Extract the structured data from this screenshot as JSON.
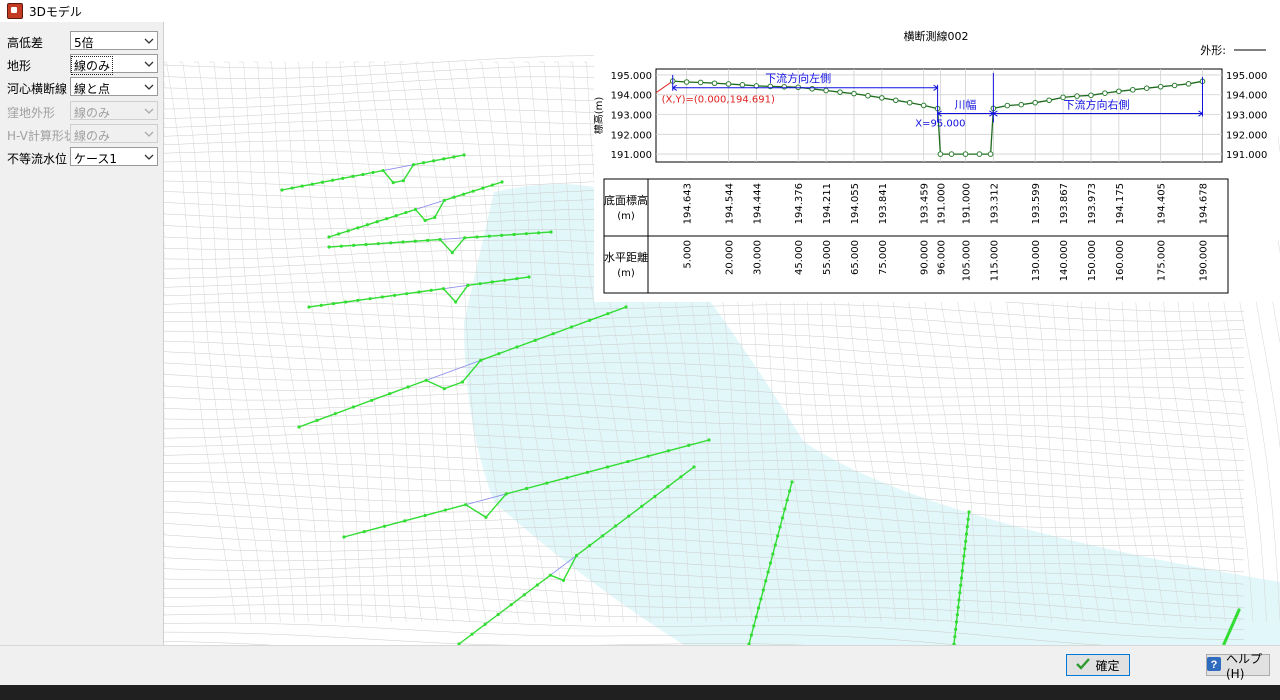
{
  "window": {
    "title": "3Dモデル"
  },
  "controls": [
    {
      "label": "高低差",
      "value": "5倍",
      "enabled": true,
      "focused": false
    },
    {
      "label": "地形",
      "value": "線のみ",
      "enabled": true,
      "focused": true
    },
    {
      "label": "河心横断線",
      "value": "線と点",
      "enabled": true,
      "focused": false
    },
    {
      "label": "窪地外形",
      "value": "線のみ",
      "enabled": false,
      "focused": false
    },
    {
      "label": "H-V計算形状",
      "value": "線のみ",
      "enabled": false,
      "focused": false
    },
    {
      "label": "不等流水位",
      "value": "ケース1",
      "enabled": true,
      "focused": false
    }
  ],
  "chart_data": {
    "type": "line",
    "title": "横断測線002",
    "legend": {
      "label": "外形:",
      "placement": "top-right"
    },
    "ylabel": "標高(m)",
    "yticks": [
      "195.000",
      "194.000",
      "193.000",
      "192.000",
      "191.000"
    ],
    "ylim": [
      190.6,
      195.3
    ],
    "xlim": [
      -6,
      197
    ],
    "points": [
      {
        "x": 0,
        "y": 194.691
      },
      {
        "x": 5,
        "y": 194.643
      },
      {
        "x": 10,
        "y": 194.62
      },
      {
        "x": 15,
        "y": 194.58
      },
      {
        "x": 20,
        "y": 194.544
      },
      {
        "x": 25,
        "y": 194.5
      },
      {
        "x": 30,
        "y": 194.444
      },
      {
        "x": 35,
        "y": 194.42
      },
      {
        "x": 40,
        "y": 194.4
      },
      {
        "x": 45,
        "y": 194.376
      },
      {
        "x": 50,
        "y": 194.3
      },
      {
        "x": 55,
        "y": 194.211
      },
      {
        "x": 60,
        "y": 194.13
      },
      {
        "x": 65,
        "y": 194.055
      },
      {
        "x": 70,
        "y": 193.95
      },
      {
        "x": 75,
        "y": 193.841
      },
      {
        "x": 80,
        "y": 193.72
      },
      {
        "x": 85,
        "y": 193.6
      },
      {
        "x": 90,
        "y": 193.459
      },
      {
        "x": 95,
        "y": 193.3
      },
      {
        "x": 96,
        "y": 191.0
      },
      {
        "x": 100,
        "y": 191.0
      },
      {
        "x": 105,
        "y": 191.0
      },
      {
        "x": 110,
        "y": 191.0
      },
      {
        "x": 114,
        "y": 191.0
      },
      {
        "x": 115,
        "y": 193.312
      },
      {
        "x": 120,
        "y": 193.45
      },
      {
        "x": 125,
        "y": 193.5
      },
      {
        "x": 130,
        "y": 193.599
      },
      {
        "x": 135,
        "y": 193.72
      },
      {
        "x": 140,
        "y": 193.867
      },
      {
        "x": 145,
        "y": 193.93
      },
      {
        "x": 150,
        "y": 193.973
      },
      {
        "x": 155,
        "y": 194.08
      },
      {
        "x": 160,
        "y": 194.175
      },
      {
        "x": 165,
        "y": 194.25
      },
      {
        "x": 170,
        "y": 194.33
      },
      {
        "x": 175,
        "y": 194.405
      },
      {
        "x": 180,
        "y": 194.47
      },
      {
        "x": 185,
        "y": 194.55
      },
      {
        "x": 190,
        "y": 194.678
      }
    ],
    "annotations": {
      "left_bank": "下流方向左側",
      "river_width": "川幅",
      "right_bank": "下流方向右側",
      "origin_point": "(X,Y)=(0.000,194.691)",
      "river_x": "X=95.000"
    },
    "table": {
      "elevation_header": "底面標高",
      "distance_header": "水平距離",
      "unit": "(m)",
      "columns": [
        {
          "distance": "5.000",
          "elevation": "194.643",
          "x": 5
        },
        {
          "distance": "20.000",
          "elevation": "194.544",
          "x": 20
        },
        {
          "distance": "30.000",
          "elevation": "194.444",
          "x": 30
        },
        {
          "distance": "45.000",
          "elevation": "194.376",
          "x": 45
        },
        {
          "distance": "55.000",
          "elevation": "194.211",
          "x": 55
        },
        {
          "distance": "65.000",
          "elevation": "194.055",
          "x": 65
        },
        {
          "distance": "75.000",
          "elevation": "193.841",
          "x": 75
        },
        {
          "distance": "90.000",
          "elevation": "193.459",
          "x": 90
        },
        {
          "distance": "96.000",
          "elevation": "191.000",
          "x": 96
        },
        {
          "distance": "105.000",
          "elevation": "191.000",
          "x": 105
        },
        {
          "distance": "115.000",
          "elevation": "193.312",
          "x": 115
        },
        {
          "distance": "130.000",
          "elevation": "193.599",
          "x": 130
        },
        {
          "distance": "140.000",
          "elevation": "193.867",
          "x": 140
        },
        {
          "distance": "150.000",
          "elevation": "193.973",
          "x": 150
        },
        {
          "distance": "160.000",
          "elevation": "194.175",
          "x": 160
        },
        {
          "distance": "175.000",
          "elevation": "194.405",
          "x": 175
        },
        {
          "distance": "190.000",
          "elevation": "194.678",
          "x": 190
        }
      ]
    }
  },
  "buttons": {
    "ok": "確定",
    "help": "ヘルプ(H)"
  },
  "colors": {
    "profile": "#1e6b1e",
    "point": "#2e7d32",
    "annotation": "#1010e0",
    "origin": "#e02020",
    "terrain_line": "#33dd33",
    "water": "#dff6f8"
  }
}
